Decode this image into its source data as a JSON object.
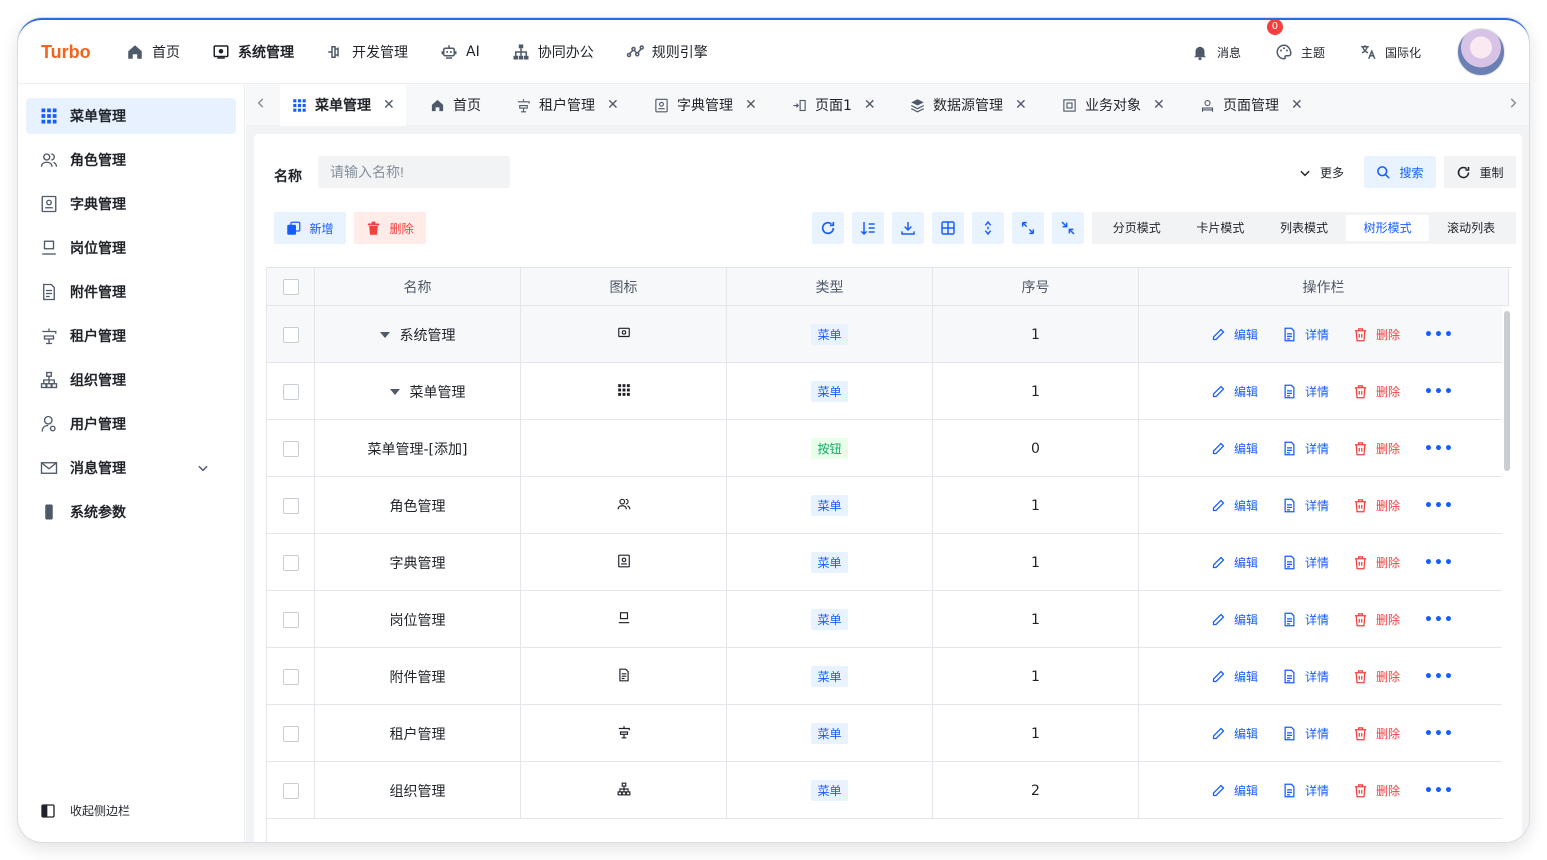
{
  "app": {
    "logo": "Turbo"
  },
  "topnav": [
    {
      "label": "首页",
      "icon": "home-icon"
    },
    {
      "label": "系统管理",
      "icon": "system-icon",
      "active": true
    },
    {
      "label": "开发管理",
      "icon": "dev-icon"
    },
    {
      "label": "AI",
      "icon": "robot-icon"
    },
    {
      "label": "协同办公",
      "icon": "org-icon"
    },
    {
      "label": "规则引擎",
      "icon": "rule-icon"
    }
  ],
  "rightnav": {
    "messages": {
      "label": "消息",
      "badge": "0"
    },
    "theme": {
      "label": "主题"
    },
    "i18n": {
      "label": "国际化"
    }
  },
  "sidebar": {
    "items": [
      {
        "label": "菜单管理",
        "icon": "grid-icon",
        "active": true
      },
      {
        "label": "角色管理",
        "icon": "users-icon"
      },
      {
        "label": "字典管理",
        "icon": "dictionary-icon"
      },
      {
        "label": "岗位管理",
        "icon": "post-icon"
      },
      {
        "label": "附件管理",
        "icon": "file-icon"
      },
      {
        "label": "租户管理",
        "icon": "tenant-icon"
      },
      {
        "label": "组织管理",
        "icon": "org-icon"
      },
      {
        "label": "用户管理",
        "icon": "user-icon"
      },
      {
        "label": "消息管理",
        "icon": "mail-icon"
      },
      {
        "label": "系统参数",
        "icon": "phone-icon"
      }
    ],
    "collapse_label": "收起侧边栏"
  },
  "tabs": [
    {
      "label": "菜单管理",
      "icon": "grid-icon",
      "active": true
    },
    {
      "label": "首页",
      "icon": "home-icon"
    },
    {
      "label": "租户管理",
      "icon": "tenant-icon"
    },
    {
      "label": "字典管理",
      "icon": "dictionary-icon"
    },
    {
      "label": "页面1",
      "icon": "page-icon"
    },
    {
      "label": "数据源管理",
      "icon": "layers-icon"
    },
    {
      "label": "业务对象",
      "icon": "object-icon"
    },
    {
      "label": "页面管理",
      "icon": "page-manage-icon"
    }
  ],
  "filter": {
    "name_label": "名称",
    "name_placeholder": "请输入名称!",
    "more_label": "更多",
    "search_label": "搜索",
    "reset_label": "重制"
  },
  "toolbar": {
    "add_label": "新增",
    "delete_label": "删除",
    "tools": [
      "refresh-icon",
      "sort-icon",
      "download-icon",
      "columns-icon",
      "expand-rows-icon",
      "fullscreen-icon",
      "exit-fullscreen-icon"
    ],
    "modes": [
      "分页模式",
      "卡片模式",
      "列表模式",
      "树形模式",
      "滚动列表"
    ],
    "active_mode": "树形模式"
  },
  "table": {
    "columns": [
      "名称",
      "图标",
      "类型",
      "序号",
      "操作栏"
    ],
    "row_actions": {
      "edit": "编辑",
      "detail": "详情",
      "delete": "删除"
    },
    "rows": [
      {
        "name": "系统管理",
        "expandable": true,
        "indent": 0,
        "icon": "system-icon",
        "type": "菜单",
        "order": "1"
      },
      {
        "name": "菜单管理",
        "expandable": true,
        "indent": 1,
        "icon": "grid-icon",
        "type": "菜单",
        "order": "1"
      },
      {
        "name": "菜单管理-[添加]",
        "expandable": false,
        "indent": 2,
        "icon": "",
        "type": "按钮",
        "order": "0"
      },
      {
        "name": "角色管理",
        "expandable": false,
        "indent": 1,
        "icon": "users-icon",
        "type": "菜单",
        "order": "1"
      },
      {
        "name": "字典管理",
        "expandable": false,
        "indent": 1,
        "icon": "dictionary-icon",
        "type": "菜单",
        "order": "1"
      },
      {
        "name": "岗位管理",
        "expandable": false,
        "indent": 1,
        "icon": "post-icon",
        "type": "菜单",
        "order": "1"
      },
      {
        "name": "附件管理",
        "expandable": false,
        "indent": 1,
        "icon": "file-icon",
        "type": "菜单",
        "order": "1"
      },
      {
        "name": "租户管理",
        "expandable": false,
        "indent": 1,
        "icon": "tenant-icon",
        "type": "菜单",
        "order": "1"
      },
      {
        "name": "组织管理",
        "expandable": false,
        "indent": 1,
        "icon": "org-icon",
        "type": "菜单",
        "order": "2"
      }
    ]
  },
  "colors": {
    "accent": "#165dff",
    "brand": "#f0641e",
    "danger": "#f53f3f"
  }
}
